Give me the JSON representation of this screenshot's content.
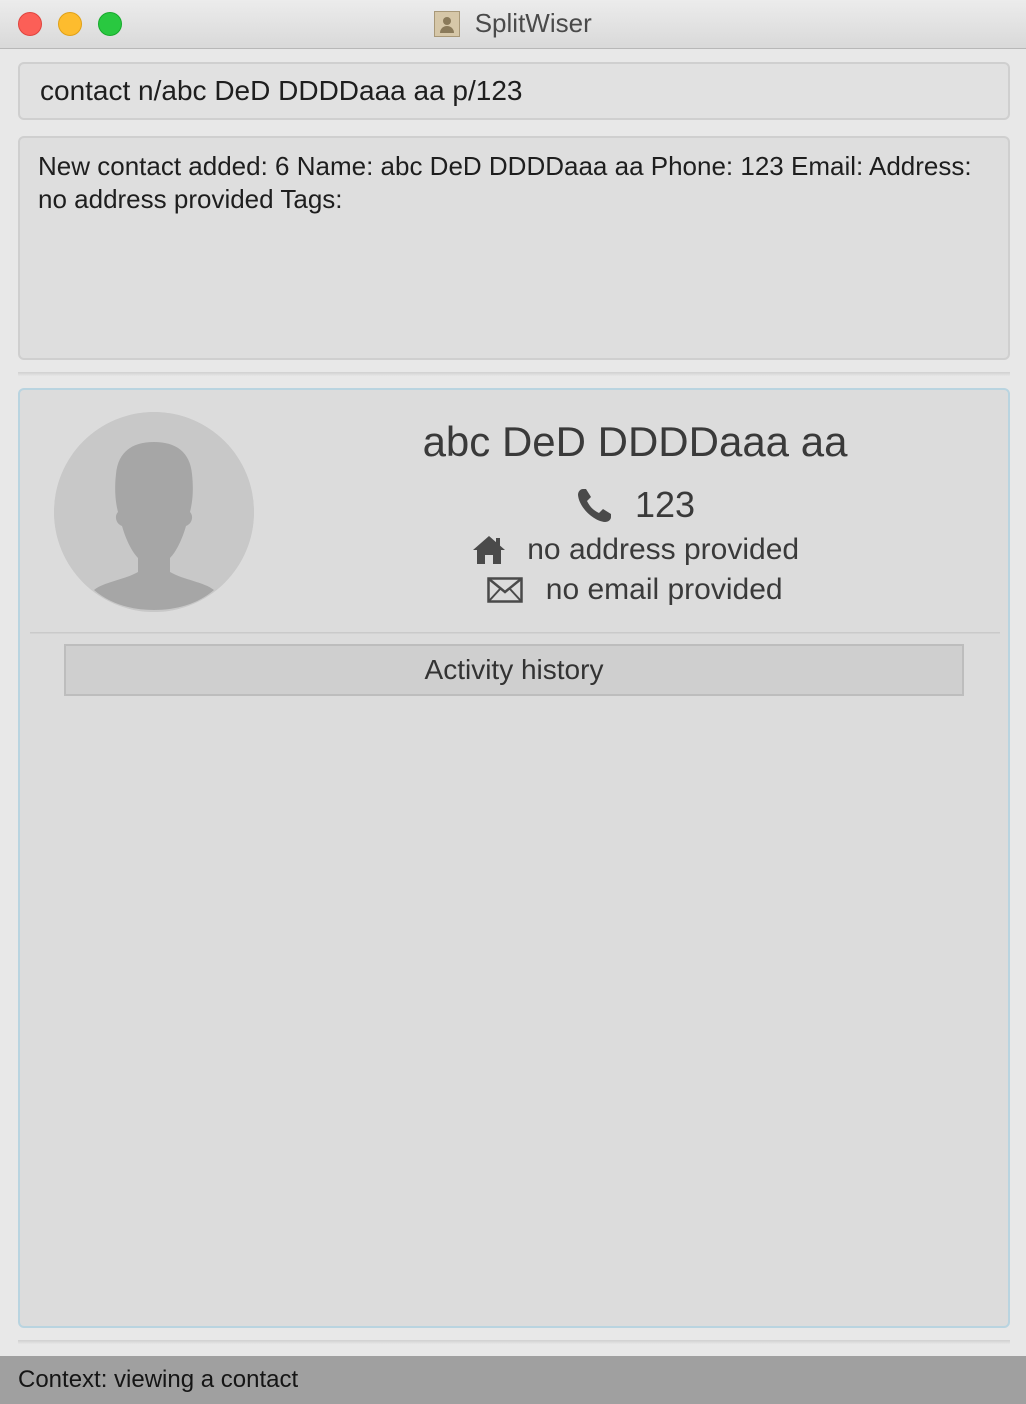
{
  "window": {
    "title": "SplitWiser"
  },
  "command_box": {
    "value": "contact n/abc DeD DDDDaaa aa p/123"
  },
  "result_display": {
    "text": "New contact added: 6 Name: abc DeD DDDDaaa aa Phone: 123 Email:  Address: no address provided Tags:"
  },
  "contact": {
    "name": "abc DeD DDDDaaa aa",
    "phone": "123",
    "address": "no address provided",
    "email": "no email provided",
    "phone_icon": "phone-icon",
    "address_icon": "home-icon",
    "email_icon": "envelope-icon"
  },
  "activity": {
    "label": "Activity history"
  },
  "status_bar": {
    "text": "Context: viewing a contact"
  },
  "colors": {
    "panel_border": "#b9d4e0",
    "status_bar_bg": "#a0a0a0"
  }
}
